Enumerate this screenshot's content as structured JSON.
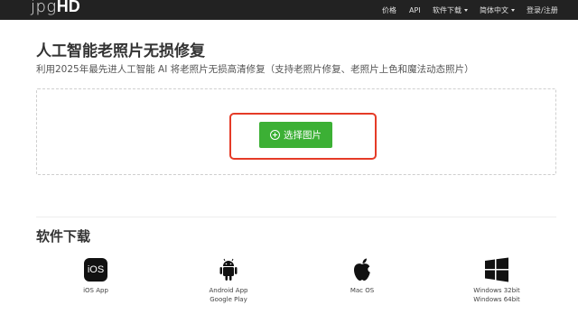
{
  "brand": {
    "logo_thin": "jpg",
    "logo_bold": "HD"
  },
  "nav": {
    "pricing": "价格",
    "api": "API",
    "software_download": "软件下载",
    "language": "简体中文",
    "login": "登录/注册"
  },
  "main": {
    "title": "人工智能老照片无损修复",
    "subtitle": "利用2025年最先进人工智能 AI 将老照片无损高清修复（支持老照片修复、老照片上色和魔法动态照片）",
    "select_button_label": "选择图片"
  },
  "downloads": {
    "section_title": "软件下载",
    "ios": {
      "icon_text": "iOS",
      "label": "iOS App"
    },
    "android": {
      "line1": "Android App",
      "line2": "Google Play"
    },
    "mac": {
      "label": "Mac OS"
    },
    "windows": {
      "line1": "Windows 32bit",
      "line2": "Windows 64bit"
    }
  },
  "colors": {
    "navbar": "#222222",
    "button_green": "#3cb035",
    "highlight_red": "#e53b27",
    "dashed_border": "#cfcfcf"
  },
  "icons": [
    "plus-circle-icon",
    "ios-icon",
    "android-icon",
    "apple-icon",
    "windows-icon",
    "caret-down-icon"
  ]
}
